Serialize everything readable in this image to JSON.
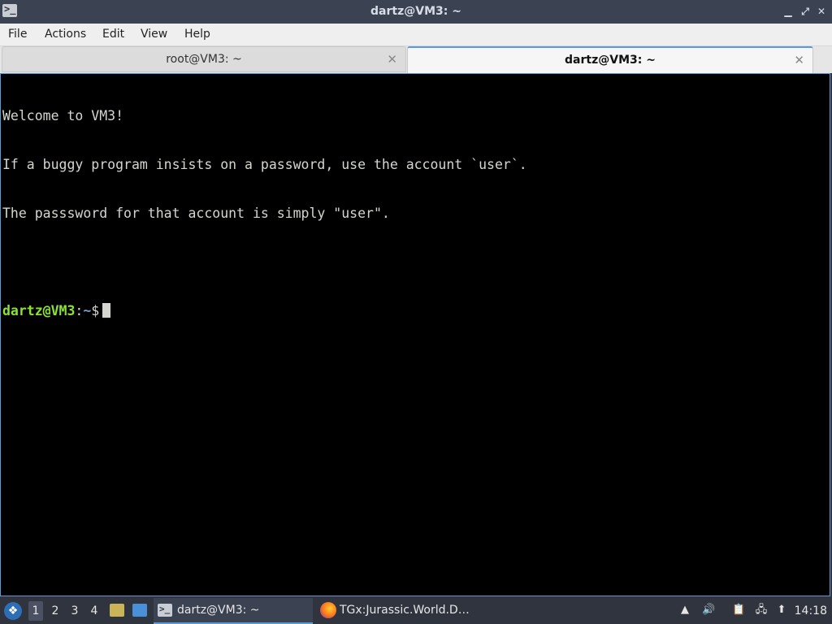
{
  "window": {
    "title": "dartz@VM3: ~"
  },
  "menubar": {
    "items": [
      "File",
      "Actions",
      "Edit",
      "View",
      "Help"
    ]
  },
  "tabs": [
    {
      "label": "root@VM3: ~",
      "active": false
    },
    {
      "label": "dartz@VM3: ~",
      "active": true
    }
  ],
  "terminal": {
    "lines": [
      "Welcome to VM3!",
      "If a buggy program insists on a password, use the account `user`.",
      "The passsword for that account is simply \"user\".",
      ""
    ],
    "prompt": {
      "user_host": "dartz@VM3",
      "separator": ":",
      "path": "~",
      "symbol": "$"
    }
  },
  "taskbar": {
    "workspaces": [
      "1",
      "2",
      "3",
      "4"
    ],
    "current_workspace": "1",
    "tasks": [
      {
        "label": "dartz@VM3: ~",
        "icon": "terminal-icon",
        "active": true
      },
      {
        "label": "TGx:Jurassic.World.D…",
        "icon": "firefox-icon",
        "active": false
      }
    ],
    "clock": "14:18"
  },
  "colors": {
    "accent": "#5b9bd5",
    "prompt_user": "#8ae234",
    "prompt_path": "#729fcf",
    "terminal_bg": "#000000",
    "terminal_fg": "#d3d7cf"
  }
}
